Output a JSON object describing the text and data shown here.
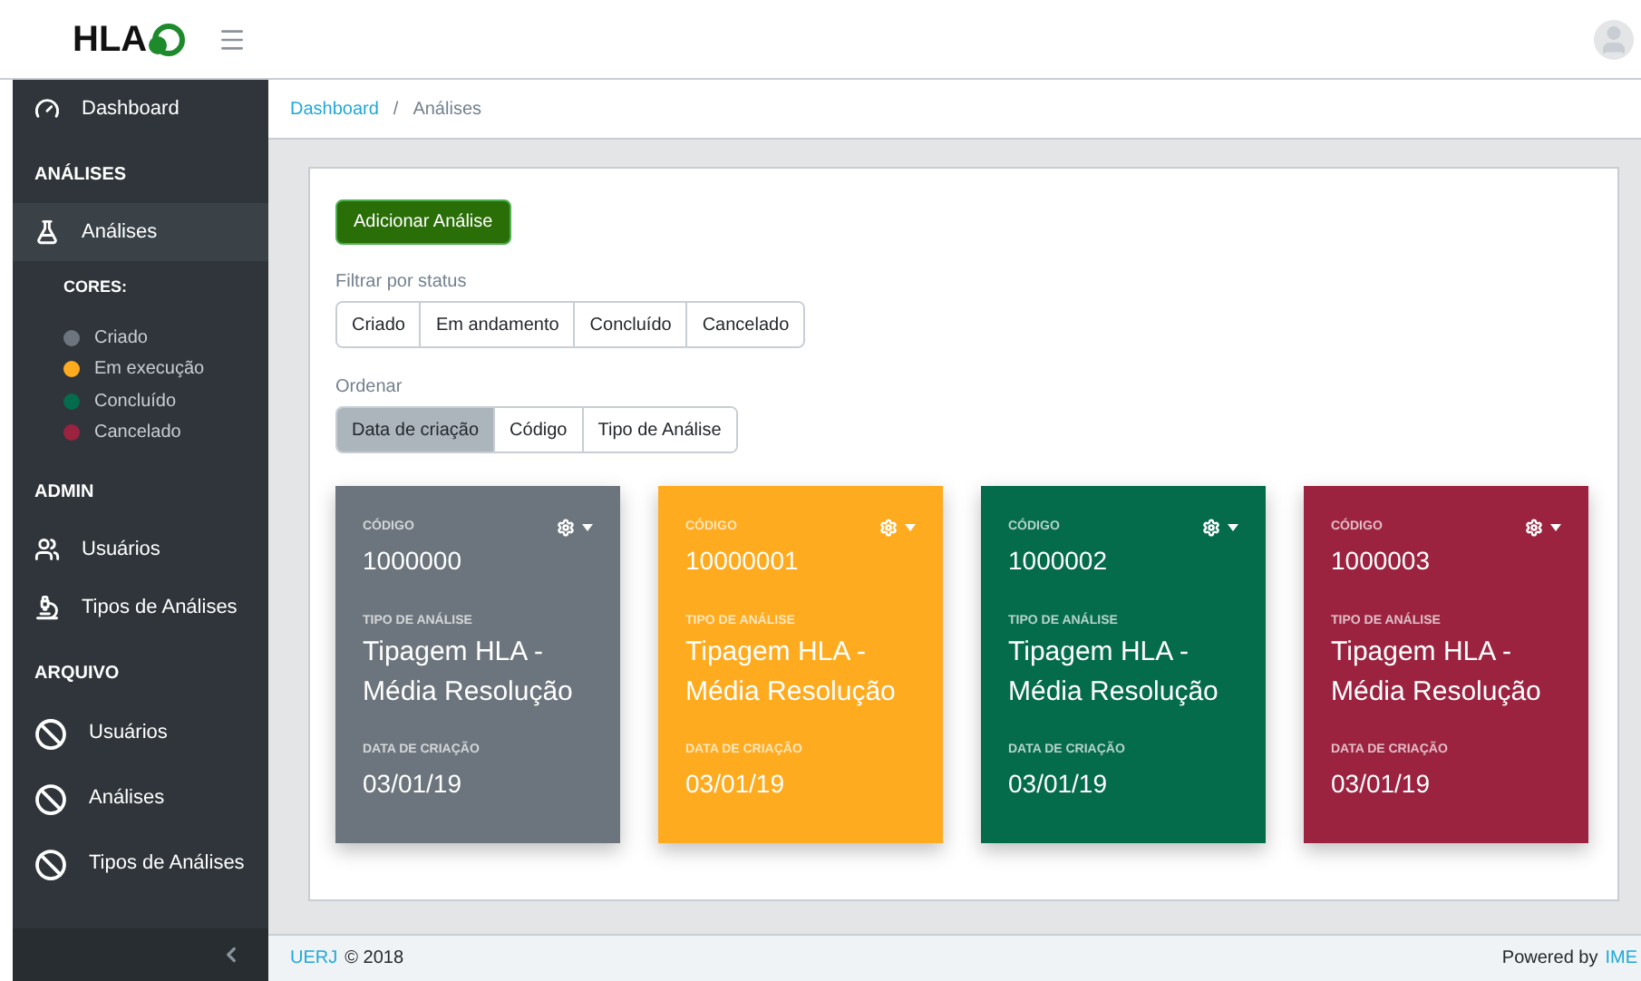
{
  "header": {
    "logo": "HLA"
  },
  "sidebar": {
    "items": [
      {
        "kind": "link",
        "label": "Dashboard",
        "selected": false
      },
      {
        "kind": "section",
        "label": "ANÁLISES"
      },
      {
        "kind": "link",
        "label": "Análises",
        "selected": true
      },
      {
        "kind": "legend",
        "title": "CORES:",
        "entries": [
          {
            "label": "Criado",
            "color": "#6c757d"
          },
          {
            "label": "Em execução",
            "color": "#ffab1f"
          },
          {
            "label": "Concluído",
            "color": "#046b4b"
          },
          {
            "label": "Cancelado",
            "color": "#9b2340"
          }
        ]
      },
      {
        "kind": "section",
        "label": "ADMIN"
      },
      {
        "kind": "link",
        "label": "Usuários",
        "selected": false
      },
      {
        "kind": "link",
        "label": "Tipos de Análises",
        "selected": false
      },
      {
        "kind": "section",
        "label": "ARQUIVO"
      },
      {
        "kind": "link",
        "label": "Usuários",
        "selected": false
      },
      {
        "kind": "link",
        "label": "Análises",
        "selected": false
      },
      {
        "kind": "link",
        "label": "Tipos de Análises",
        "selected": false
      }
    ]
  },
  "breadcrumb": [
    {
      "label": "Dashboard",
      "kind": "link"
    },
    {
      "label": "/",
      "kind": "separator"
    },
    {
      "label": "Análises",
      "kind": "current"
    }
  ],
  "add_button": "Adicionar Análise",
  "filter": {
    "label": "Filtrar por status",
    "options": [
      {
        "label": "Criado",
        "selected": false
      },
      {
        "label": "Em andamento",
        "selected": false
      },
      {
        "label": "Concluído",
        "selected": false
      },
      {
        "label": "Cancelado",
        "selected": false
      }
    ]
  },
  "sort": {
    "label": "Ordenar",
    "options": [
      {
        "label": "Data de criação",
        "selected": true
      },
      {
        "label": "Código",
        "selected": false
      },
      {
        "label": "Tipo de Análise",
        "selected": false
      }
    ]
  },
  "cards": [
    {
      "color": "#6c757d",
      "code_label": "CÓDIGO",
      "code": "1000000",
      "type_label": "TIPO DE ANÁLISE",
      "type": "Tipagem HLA - Média Resolução",
      "date_label": "DATA DE CRIAÇÃO",
      "date": "03/01/19"
    },
    {
      "color": "#ffab1f",
      "code_label": "CÓDIGO",
      "code": "10000001",
      "type_label": "TIPO DE ANÁLISE",
      "type": "Tipagem HLA - Média Resolução",
      "date_label": "DATA DE CRIAÇÃO",
      "date": "03/01/19"
    },
    {
      "color": "#046b4b",
      "code_label": "CÓDIGO",
      "code": "1000002",
      "type_label": "TIPO DE ANÁLISE",
      "type": "Tipagem HLA - Média Resolução",
      "date_label": "DATA DE CRIAÇÃO",
      "date": "03/01/19"
    },
    {
      "color": "#9b2340",
      "code_label": "CÓDIGO",
      "code": "1000003",
      "type_label": "TIPO DE ANÁLISE",
      "type": "Tipagem HLA - Média Resolução",
      "date_label": "DATA DE CRIAÇÃO",
      "date": "03/01/19"
    }
  ],
  "footer": {
    "left_link": "UERJ",
    "left_text": "© 2018",
    "right_text": "Powered by",
    "right_link": "IME"
  }
}
